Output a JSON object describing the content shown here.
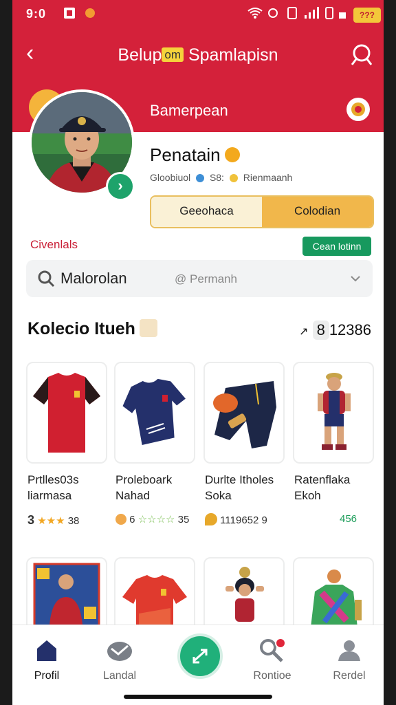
{
  "status_bar": {
    "time": "9:0",
    "battery": "???"
  },
  "app_bar": {
    "title_left": "Belup",
    "title_highlight": "om",
    "title_right": "Spamlapisn"
  },
  "profile": {
    "subtitle": "Bamerpean",
    "name": "Penatain",
    "meta_a": "Gloobiuol",
    "meta_b": "S8:",
    "meta_c": "Rienmaanh",
    "segment": [
      "Geeohaca",
      "Colodian"
    ]
  },
  "filter": {
    "label": "Civenlals",
    "button": "Cean lotinn"
  },
  "search": {
    "value": "Malorolan",
    "placeholder": "@ Permanh"
  },
  "collection": {
    "title": "Kolecio Itueh",
    "count_prefix": "8",
    "count_rest": "12386"
  },
  "items": [
    {
      "title_line1": "Prtlles03s",
      "title_line2": "liarmasa",
      "rating": "3",
      "rating_value": "38",
      "stars": 3
    },
    {
      "title_line1": "Proleboark",
      "title_line2": "Nahad",
      "rating": "6",
      "rating_value": "35",
      "stars": 4
    },
    {
      "title_line1": "Durlte Itholes",
      "title_line2": "Soka",
      "rating": "",
      "rating_value": "1119652 9",
      "stars": 0
    },
    {
      "title_line1": "Ratenflaka",
      "title_line2": "Ekoh",
      "rating": "",
      "rating_value": "456",
      "stars": 0
    }
  ],
  "nav": [
    {
      "label": "Profil"
    },
    {
      "label": "Landal"
    },
    {
      "label": ""
    },
    {
      "label": "Rontioe"
    },
    {
      "label": "Rerdel"
    }
  ],
  "colors": {
    "brand_red": "#d4213a",
    "accent_green": "#17995e",
    "accent_orange": "#f1b74b"
  }
}
